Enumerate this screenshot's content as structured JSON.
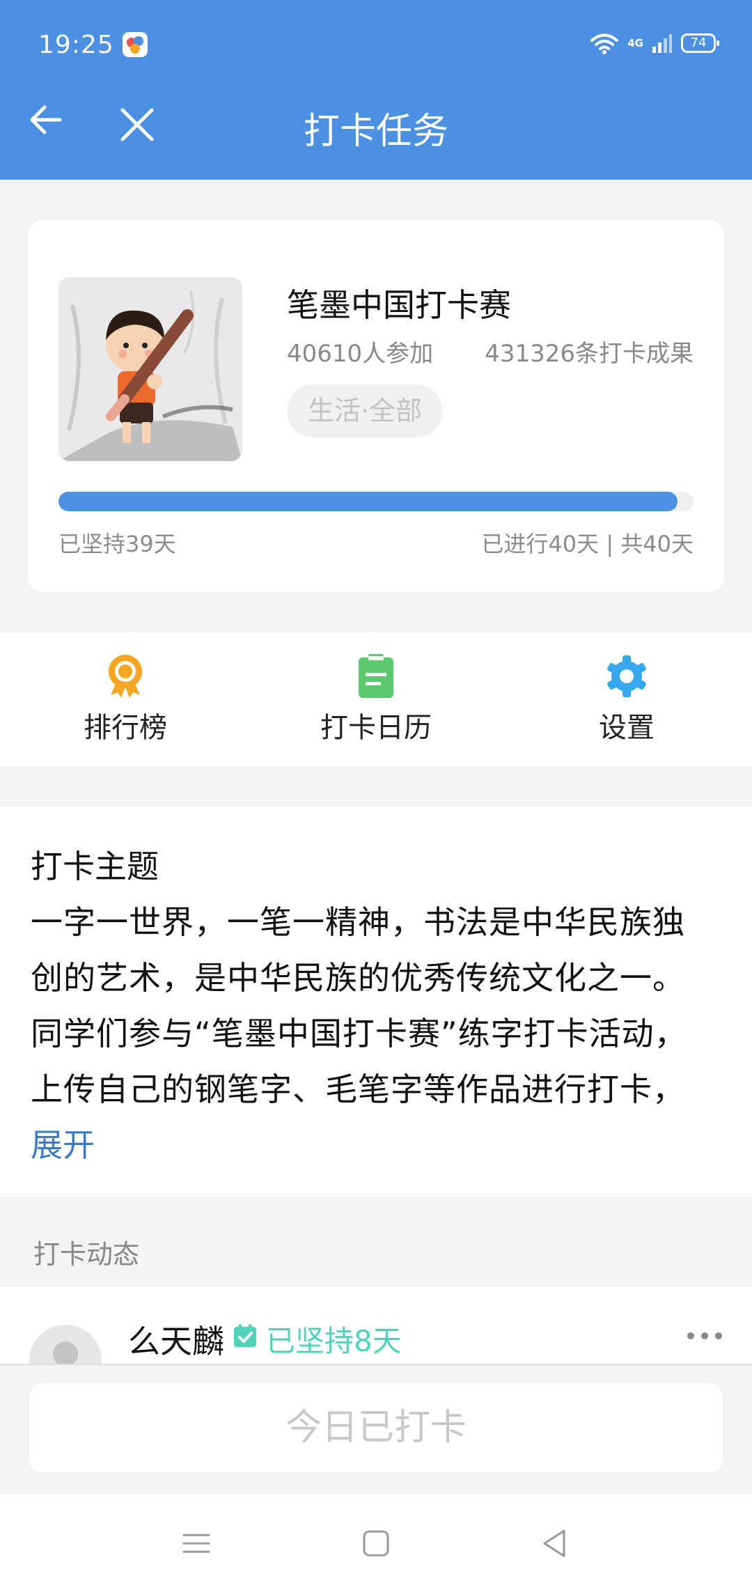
{
  "status_bar": {
    "time": "19:25",
    "network": "4G",
    "battery": "74"
  },
  "header": {
    "title": "打卡任务",
    "background": "#4b90e2"
  },
  "task": {
    "title": "笔墨中国打卡赛",
    "participants": "40610人参加",
    "results": "431326条打卡成果",
    "category": "生活·全部",
    "progress_fraction": 0.975,
    "persisted": "已坚持39天",
    "elapsed": "已进行40天 | 共40天"
  },
  "actions": [
    {
      "label": "排行榜",
      "icon": "medal-icon",
      "color": "#f5a623"
    },
    {
      "label": "打卡日历",
      "icon": "calendar-clipboard-icon",
      "color": "#5cc86e"
    },
    {
      "label": "设置",
      "icon": "gear-icon",
      "color": "#35a8f0"
    }
  ],
  "theme": {
    "heading": "打卡主题",
    "lines": [
      "一字一世界，一笔一精神，书法是中华民族独",
      "创的艺术，是中华民族的优秀传统文化之一。",
      "同学们参与“笔墨中国打卡赛”练字打卡活动，",
      "上传自己的钢笔字、毛笔字等作品进行打卡，"
    ],
    "expand": "展开"
  },
  "feed": {
    "heading": "打卡动态",
    "items": [
      {
        "name": "么天麟",
        "streak": "已坚持8天"
      }
    ]
  },
  "bottom": {
    "checkin_label": "今日已打卡"
  }
}
